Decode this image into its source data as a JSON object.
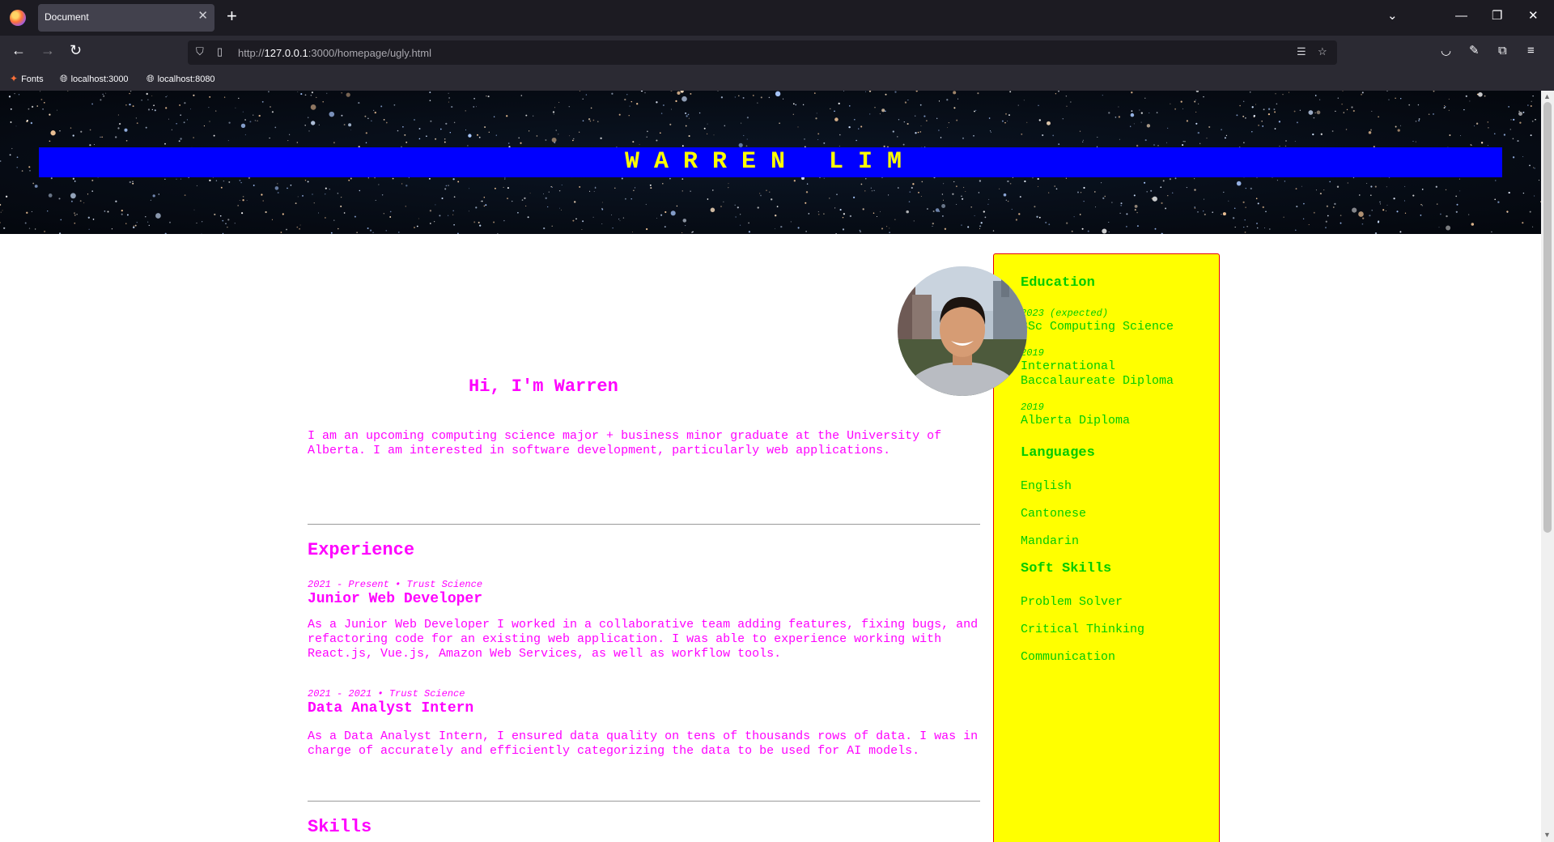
{
  "browser": {
    "tab_title": "Document",
    "url_prefix": "http://",
    "url_host": "127.0.0.1",
    "url_rest": ":3000/homepage/ugly.html",
    "bookmarks": [
      "Fonts",
      "localhost:3000",
      "localhost:8080"
    ]
  },
  "header": {
    "name": "WARREN LIM"
  },
  "intro": {
    "greeting": "Hi, I'm Warren",
    "text": "I am an upcoming computing science major + business minor graduate at the University of Alberta. I am interested in software development, particularly web applications."
  },
  "experience": {
    "heading": "Experience",
    "jobs": [
      {
        "meta": "2021 - Present • Trust Science",
        "title": "Junior Web Developer",
        "description": "As a Junior Web Developer I worked in a collaborative team adding features, fixing bugs, and refactoring code for an existing web application. I was able to experience working with React.js, Vue.js, Amazon Web Services, as well as workflow tools."
      },
      {
        "meta": "2021 - 2021 • Trust Science",
        "title": "Data Analyst Intern",
        "description": "As a Data Analyst Intern, I ensured data quality on tens of thousands rows of data. I was in charge of accurately and efficiently categorizing the data to be used for AI models."
      }
    ]
  },
  "skills": {
    "heading": "Skills"
  },
  "sidebar": {
    "education_heading": "Education",
    "education": [
      {
        "year": "2023 (expected)",
        "degree": "BSc Computing Science"
      },
      {
        "year": "2019",
        "degree": "International Baccalaureate Diploma"
      },
      {
        "year": "2019",
        "degree": "Alberta Diploma"
      }
    ],
    "languages_heading": "Languages",
    "languages": [
      "English",
      "Cantonese",
      "Mandarin"
    ],
    "soft_skills_heading": "Soft Skills",
    "soft_skills": [
      "Problem Solver",
      "Critical Thinking",
      "Communication"
    ]
  },
  "colors": {
    "title_bar": "#0000ff",
    "title_text": "#ffff00",
    "main_text": "#ff00ff",
    "sidebar_bg": "#ffff00",
    "sidebar_text": "#00cc00",
    "sidebar_border": "#e60000"
  }
}
